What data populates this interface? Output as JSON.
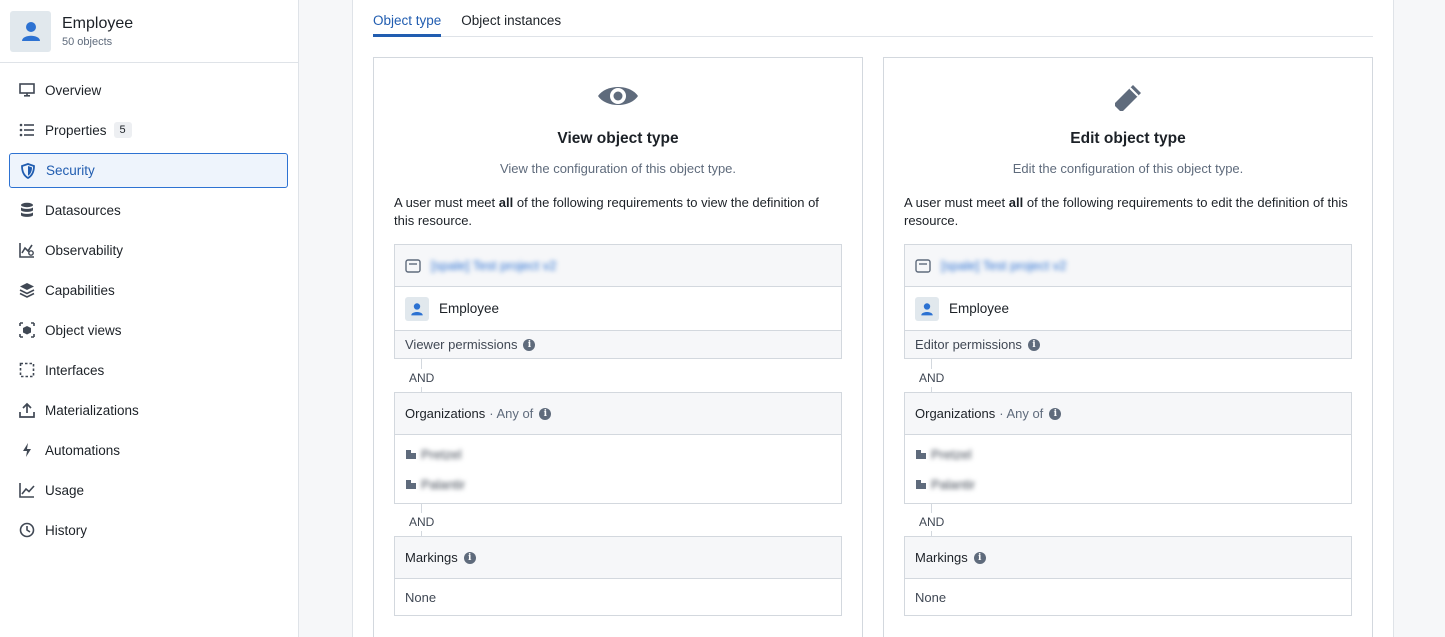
{
  "object": {
    "title": "Employee",
    "subtitle": "50 objects"
  },
  "sidebar": {
    "items": [
      {
        "label": "Overview",
        "icon": "monitor-icon"
      },
      {
        "label": "Properties",
        "icon": "list-icon",
        "badge": "5"
      },
      {
        "label": "Security",
        "icon": "shield-icon",
        "active": true
      },
      {
        "label": "Datasources",
        "icon": "database-icon"
      },
      {
        "label": "Observability",
        "icon": "chart-icon"
      },
      {
        "label": "Capabilities",
        "icon": "layers-icon"
      },
      {
        "label": "Object views",
        "icon": "cube-icon"
      },
      {
        "label": "Interfaces",
        "icon": "dashed-square-icon"
      },
      {
        "label": "Materializations",
        "icon": "upload-icon"
      },
      {
        "label": "Automations",
        "icon": "lightning-icon"
      },
      {
        "label": "Usage",
        "icon": "line-chart-icon"
      },
      {
        "label": "History",
        "icon": "clock-icon"
      }
    ]
  },
  "tabs": [
    {
      "label": "Object type",
      "active": true
    },
    {
      "label": "Object instances"
    }
  ],
  "cards": [
    {
      "icon": "eye-icon",
      "title": "View object type",
      "desc": "View the configuration of this object type.",
      "req_prefix": "A user must meet ",
      "req_bold": "all",
      "req_suffix": " of the following requirements to view the definition of this resource.",
      "project": "[spale] Test project v2",
      "object_name": "Employee",
      "permissions": "Viewer permissions",
      "and1": "AND",
      "orgs_label": "Organizations",
      "orgs_any": "· Any of",
      "org1": "Pretzel",
      "org2": "Palantir",
      "and2": "AND",
      "markings_label": "Markings",
      "markings_value": "None"
    },
    {
      "icon": "pencil-icon",
      "title": "Edit object type",
      "desc": "Edit the configuration of this object type.",
      "req_prefix": "A user must meet ",
      "req_bold": "all",
      "req_suffix": " of the following requirements to edit the definition of this resource.",
      "project": "[spale] Test project v2",
      "object_name": "Employee",
      "permissions": "Editor permissions",
      "and1": "AND",
      "orgs_label": "Organizations",
      "orgs_any": "· Any of",
      "org1": "Pretzel",
      "org2": "Palantir",
      "and2": "AND",
      "markings_label": "Markings",
      "markings_value": "None"
    }
  ]
}
